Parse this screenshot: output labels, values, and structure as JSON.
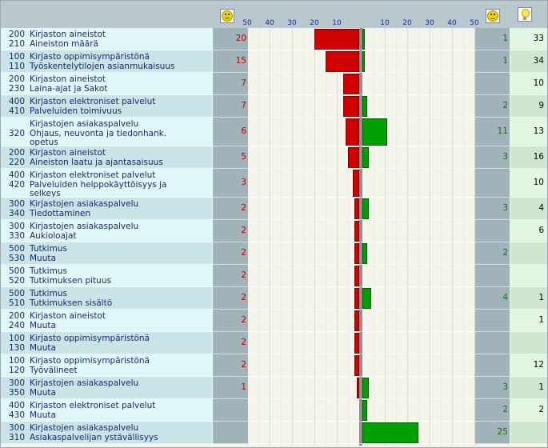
{
  "icons": {
    "negative": "sad-face-icon",
    "positive": "happy-face-icon",
    "ideas": "lightbulb-icon"
  },
  "colors": {
    "negative_bar": "#d00000",
    "positive_bar": "#00a000",
    "label_row_light": "#e0f8f8",
    "label_row_dark": "#c8e4e6",
    "value_col": "#9fb3b8",
    "idea_col": "#cfe7cf",
    "tick_text": "#1a2aa8",
    "neg_text": "#c00000",
    "pos_text": "#1a6a1a"
  },
  "chart_data": {
    "type": "bar",
    "layout": "diverging-horizontal",
    "left_ticks": [
      "50",
      "40",
      "30",
      "20",
      "10"
    ],
    "right_ticks": [
      "10",
      "20",
      "30",
      "40",
      "50"
    ],
    "xlim": [
      0,
      50
    ],
    "rows": [
      {
        "code1": "200",
        "group": "Kirjaston aineistot",
        "code2": "210",
        "lines": [
          "Aineiston määrä"
        ],
        "negative": 20,
        "positive": 1,
        "ideas": 33
      },
      {
        "code1": "100",
        "group": "Kirjasto oppimisympäristönä",
        "code2": "110",
        "lines": [
          "Työskentelytilojen asianmukaisuus"
        ],
        "negative": 15,
        "positive": 1,
        "ideas": 34
      },
      {
        "code1": "200",
        "group": "Kirjaston aineistot",
        "code2": "230",
        "lines": [
          "Laina-ajat ja Sakot"
        ],
        "negative": 7,
        "positive": null,
        "ideas": 10
      },
      {
        "code1": "400",
        "group": "Kirjaston elektroniset palvelut",
        "code2": "410",
        "lines": [
          "Palveluiden toimivuus"
        ],
        "negative": 7,
        "positive": 2,
        "ideas": 9
      },
      {
        "code1": "",
        "group": "Kirjastojen asiakaspalvelu",
        "code2": "320",
        "lines": [
          "Ohjaus, neuvonta ja tiedonhank.",
          "opetus"
        ],
        "negative": 6,
        "positive": 11,
        "ideas": 13
      },
      {
        "code1": "200",
        "group": "Kirjaston aineistot",
        "code2": "220",
        "lines": [
          "Aineiston laatu ja ajantasaisuus"
        ],
        "negative": 5,
        "positive": 3,
        "ideas": 16
      },
      {
        "code1": "400",
        "group": "Kirjaston elektroniset palvelut",
        "code2": "420",
        "lines": [
          "Palveluiden helppokäyttöisyys ja",
          "selkeys"
        ],
        "negative": 3,
        "positive": null,
        "ideas": 10
      },
      {
        "code1": "300",
        "group": "Kirjastojen asiakaspalvelu",
        "code2": "340",
        "lines": [
          "Tiedottaminen"
        ],
        "negative": 2,
        "positive": 3,
        "ideas": 4
      },
      {
        "code1": "300",
        "group": "Kirjastojen asiakaspalvelu",
        "code2": "330",
        "lines": [
          "Aukioloajat"
        ],
        "negative": 2,
        "positive": null,
        "ideas": 6
      },
      {
        "code1": "500",
        "group": "Tutkimus",
        "code2": "530",
        "lines": [
          "Muuta"
        ],
        "negative": 2,
        "positive": 2,
        "ideas": null
      },
      {
        "code1": "500",
        "group": "Tutkimus",
        "code2": "520",
        "lines": [
          "Tutkimuksen pituus"
        ],
        "negative": 2,
        "positive": null,
        "ideas": null
      },
      {
        "code1": "500",
        "group": "Tutkimus",
        "code2": "510",
        "lines": [
          "Tutkimuksen sisältö"
        ],
        "negative": 2,
        "positive": 4,
        "ideas": 1
      },
      {
        "code1": "200",
        "group": "Kirjaston aineistot",
        "code2": "240",
        "lines": [
          "Muuta"
        ],
        "negative": 2,
        "positive": null,
        "ideas": 1
      },
      {
        "code1": "100",
        "group": "Kirjasto oppimisympäristönä",
        "code2": "130",
        "lines": [
          "Muuta"
        ],
        "negative": 2,
        "positive": null,
        "ideas": null
      },
      {
        "code1": "100",
        "group": "Kirjasto oppimisympäristönä",
        "code2": "120",
        "lines": [
          "Työvälineet"
        ],
        "negative": 2,
        "positive": null,
        "ideas": 12
      },
      {
        "code1": "300",
        "group": "Kirjastojen asiakaspalvelu",
        "code2": "350",
        "lines": [
          "Muuta"
        ],
        "negative": 1,
        "positive": 3,
        "ideas": 1
      },
      {
        "code1": "400",
        "group": "Kirjaston elektroniset palvelut",
        "code2": "430",
        "lines": [
          "Muuta"
        ],
        "negative": null,
        "positive": 2,
        "ideas": 2
      },
      {
        "code1": "300",
        "group": "Kirjastojen asiakaspalvelu",
        "code2": "310",
        "lines": [
          "Asiakaspalvelijan ystävällisyys"
        ],
        "negative": null,
        "positive": 25,
        "ideas": null
      }
    ]
  }
}
